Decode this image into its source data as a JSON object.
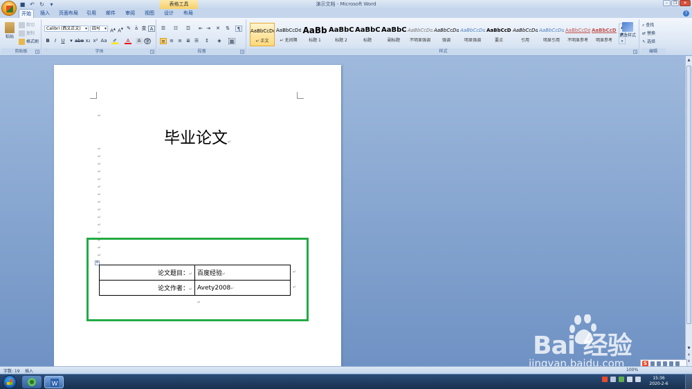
{
  "window": {
    "title": "演示文档 - Microsoft Word",
    "contextual_tab": "表格工具"
  },
  "tabs": [
    {
      "label": "开始"
    },
    {
      "label": "插入"
    },
    {
      "label": "页面布局"
    },
    {
      "label": "引用"
    },
    {
      "label": "邮件"
    },
    {
      "label": "审阅"
    },
    {
      "label": "视图"
    },
    {
      "label": "设计"
    },
    {
      "label": "布局"
    }
  ],
  "ribbon": {
    "clipboard": {
      "label": "剪贴板",
      "paste": "粘贴",
      "cut": "剪切",
      "copy": "复制",
      "format_painter": "格式刷"
    },
    "font": {
      "label": "字体",
      "name": "Calibri (西文正文)",
      "size": "四号"
    },
    "paragraph": {
      "label": "段落"
    },
    "styles": {
      "label": "样式",
      "items": [
        {
          "sample": "AaBbCcDd",
          "name": "↵ 正文"
        },
        {
          "sample": "AaBbCcDd",
          "name": "↵ 无间隔"
        },
        {
          "sample": "AaBb",
          "name": "标题 1"
        },
        {
          "sample": "AaBbC",
          "name": "标题 2"
        },
        {
          "sample": "AaBbC",
          "name": "标题"
        },
        {
          "sample": "AaBbC",
          "name": "副标题"
        },
        {
          "sample": "AaBbCcDd",
          "name": "不明显强调"
        },
        {
          "sample": "AaBbCcDd",
          "name": "强调"
        },
        {
          "sample": "AaBbCcDd",
          "name": "明显强调"
        },
        {
          "sample": "AaBbCcDd",
          "name": "要点"
        },
        {
          "sample": "AaBbCcDd",
          "name": "引用"
        },
        {
          "sample": "AaBbCcDd",
          "name": "明显引用"
        },
        {
          "sample": "AaBbCcDd",
          "name": "不明显参考"
        },
        {
          "sample": "AaBbCcDd",
          "name": "明显参考"
        }
      ],
      "change_styles": "更改样式"
    },
    "editing": {
      "label": "编辑",
      "find": "查找",
      "replace": "替换",
      "select": "选择"
    }
  },
  "document": {
    "title": "毕业论文",
    "table": [
      {
        "label": "论文题目：",
        "value": "百度经验"
      },
      {
        "label": "论文作者：",
        "value": "Avety2008"
      }
    ]
  },
  "status": {
    "word_count": "字数: 19",
    "mode": "插入",
    "zoom": "100%"
  },
  "taskbar": {
    "time": "15:36",
    "date": "2020-2-6"
  },
  "watermark": {
    "brand": "Bai  经验",
    "url": "jingyan.baidu.com"
  },
  "colors": {
    "highlight_box": "#22aa44",
    "ribbon_bg": "#dbe6f4",
    "workspace": "#7f9fcb"
  }
}
